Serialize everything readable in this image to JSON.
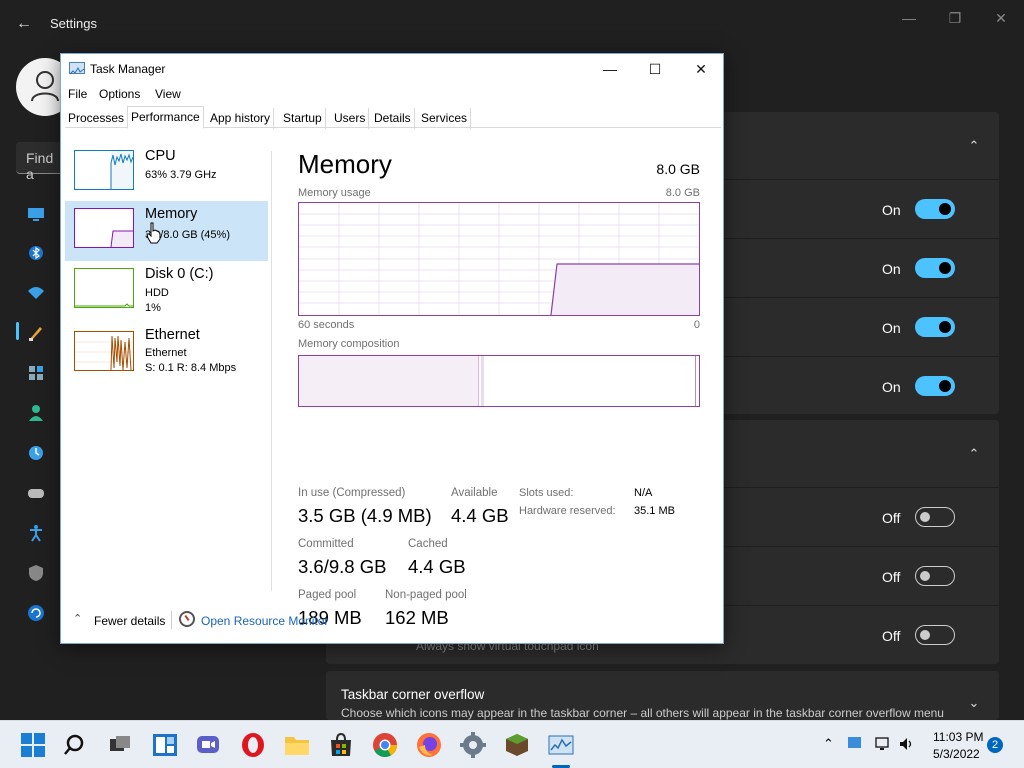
{
  "settings": {
    "title": "Settings",
    "search_placeholder": "Find a",
    "toggles": [
      {
        "label": "On"
      },
      {
        "label": "On"
      },
      {
        "label": "On"
      },
      {
        "label": "On"
      },
      {
        "label": "Off"
      },
      {
        "label": "Off"
      },
      {
        "label": "Off"
      }
    ],
    "ghost_text": "Always show virtual touchpad icon",
    "corner_overflow": {
      "title": "Taskbar corner overflow",
      "description": "Choose which icons may appear in the taskbar corner – all others will appear in the taskbar corner overflow menu"
    },
    "accent_color": "#4cc2ff"
  },
  "task_manager": {
    "title": "Task Manager",
    "menu": [
      "File",
      "Options",
      "View"
    ],
    "tabs": [
      "Processes",
      "Performance",
      "App history",
      "Startup",
      "Users",
      "Details",
      "Services"
    ],
    "active_tab": "Performance",
    "sidebar": [
      {
        "name": "CPU",
        "sub1": "63%  3.79 GHz",
        "sub2": "",
        "color": "#117dbb"
      },
      {
        "name": "Memory",
        "sub1": "3.6/8.0 GB (45%)",
        "sub2": "",
        "color": "#8b12ae",
        "selected": true
      },
      {
        "name": "Disk 0 (C:)",
        "sub1": "HDD",
        "sub2": "1%",
        "color": "#4da60c"
      },
      {
        "name": "Ethernet",
        "sub1": "Ethernet",
        "sub2": "S: 0.1  R: 8.4 Mbps",
        "color": "#a74f01"
      }
    ],
    "memory": {
      "title": "Memory",
      "total": "8.0 GB",
      "usage_label": "Memory usage",
      "usage_max": "8.0 GB",
      "time_left": "60 seconds",
      "time_right": "0",
      "composition_label": "Memory composition",
      "in_use_fraction": 0.45,
      "stats": {
        "in_use_label": "In use (Compressed)",
        "in_use_value": "3.5 GB (4.9 MB)",
        "available_label": "Available",
        "available_value": "4.4 GB",
        "committed_label": "Committed",
        "committed_value": "3.6/9.8 GB",
        "cached_label": "Cached",
        "cached_value": "4.4 GB",
        "paged_label": "Paged pool",
        "paged_value": "189 MB",
        "nonpaged_label": "Non-paged pool",
        "nonpaged_value": "162 MB"
      },
      "details": {
        "slots_label": "Slots used:",
        "slots_value": "N/A",
        "reserved_label": "Hardware reserved:",
        "reserved_value": "35.1 MB"
      }
    },
    "footer": {
      "fewer_details": "Fewer details",
      "open_resource_monitor": "Open Resource Monitor"
    }
  },
  "taskbar": {
    "pinned": [
      "start-icon",
      "search-icon",
      "task-view-icon",
      "widgets-icon",
      "chat-icon",
      "opera-icon",
      "file-explorer-icon",
      "store-icon",
      "chrome-icon",
      "firefox-icon",
      "settings-icon",
      "minecraft-icon",
      "task-manager-icon"
    ],
    "clock_time": "11:03 PM",
    "clock_date": "5/3/2022",
    "notification_count": "2"
  }
}
